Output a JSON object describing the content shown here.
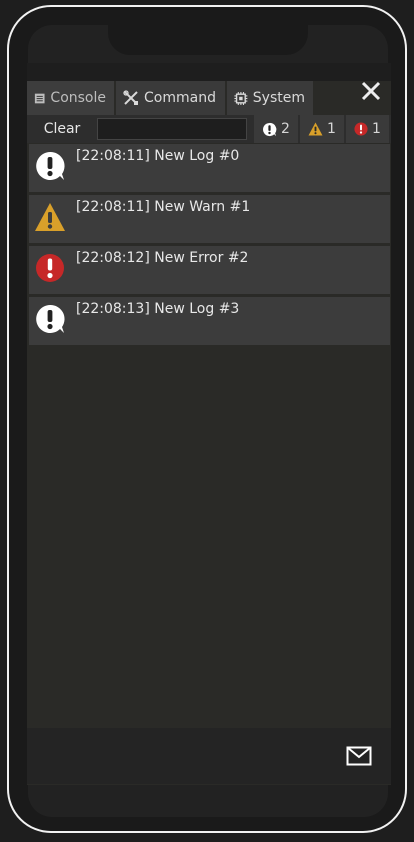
{
  "tabs": [
    {
      "label": "Console",
      "icon": "console-icon"
    },
    {
      "label": "Command",
      "icon": "tools-icon"
    },
    {
      "label": "System",
      "icon": "chip-icon"
    }
  ],
  "toolbar": {
    "clear_label": "Clear",
    "search_value": "",
    "counts": {
      "info": "2",
      "warn": "1",
      "error": "1"
    }
  },
  "logs": [
    {
      "level": "info",
      "text": "[22:08:11] New Log #0"
    },
    {
      "level": "warn",
      "text": "[22:08:11] New Warn #1"
    },
    {
      "level": "error",
      "text": "[22:08:12] New Error #2"
    },
    {
      "level": "info",
      "text": "[22:08:13] New Log #3"
    }
  ],
  "colors": {
    "warn": "#d9a02a",
    "error": "#c62828",
    "info": "#ffffff",
    "background": "#2a2a27"
  }
}
